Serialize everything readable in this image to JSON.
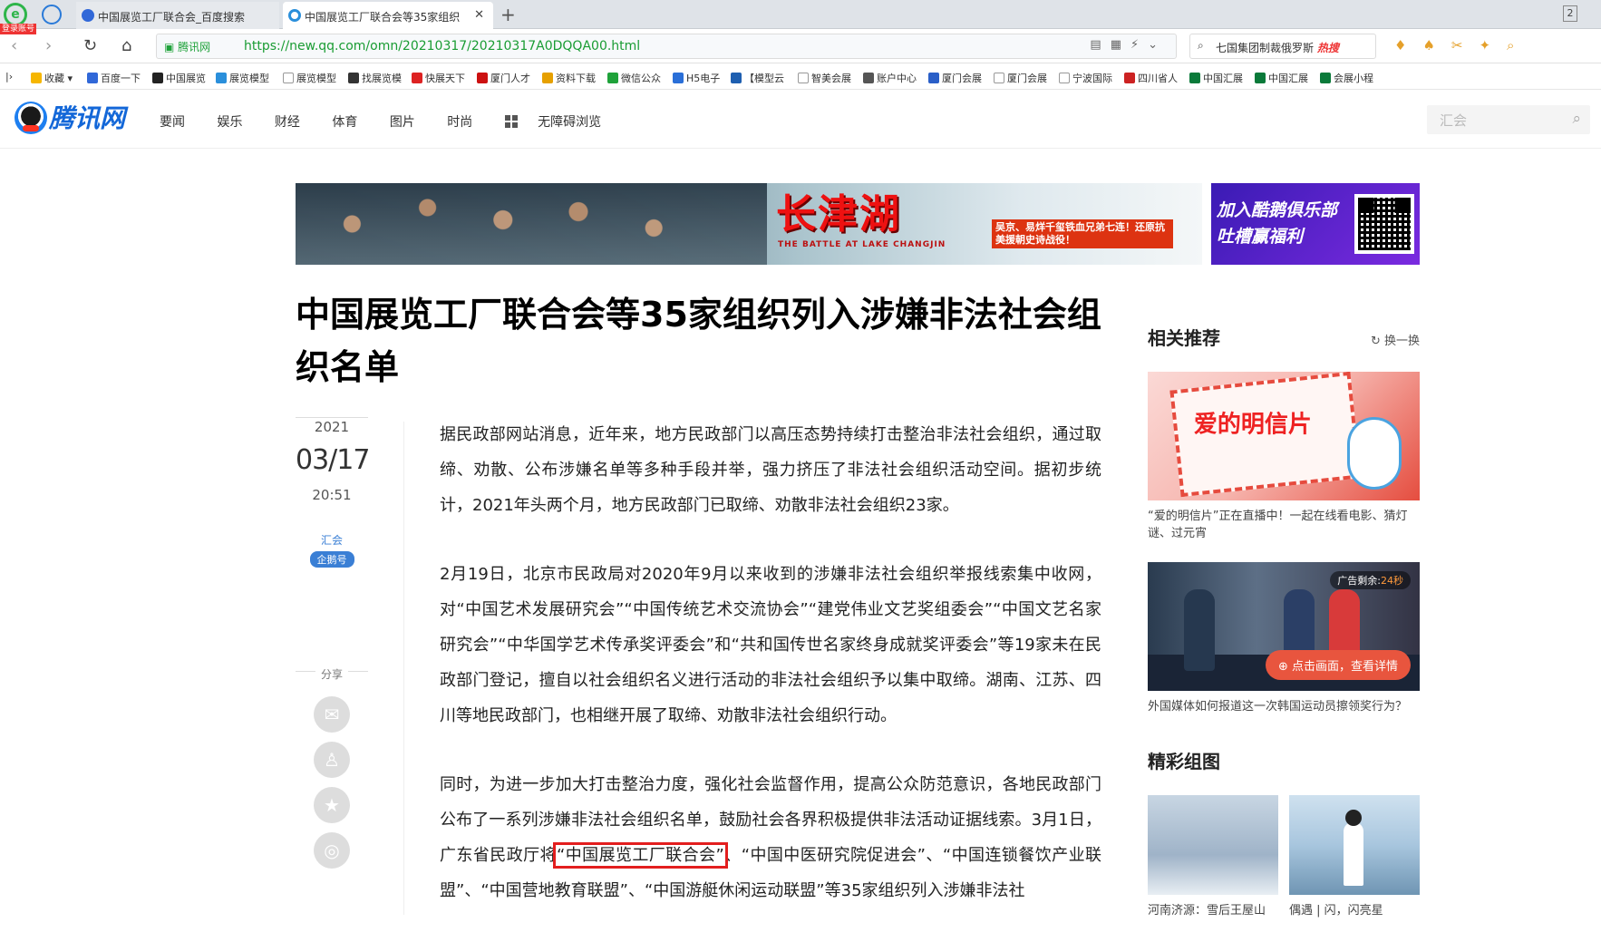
{
  "browser": {
    "logo_glyph": "e",
    "login_badge": "登录账号",
    "tabs": [
      {
        "title": "中国展览工厂联合会_百度搜索",
        "active": false
      },
      {
        "title": "中国展览工厂联合会等35家组织",
        "active": true
      }
    ],
    "new_tab": "+",
    "close": "✕",
    "window_count": "2",
    "url_site": "腾讯网",
    "url": "https://new.qq.com/omn/20210317/20210317A0DQQA00.html",
    "search_text": "七国集团制裁俄罗斯",
    "search_hot": "热搜",
    "bookmarks": [
      "收藏",
      "百度一下",
      "中国展览",
      "展览模型",
      "展览模型",
      "找展览模",
      "快展天下",
      "厦门人才",
      "资料下载",
      "微信公众",
      "H5电子",
      "【模型云",
      "智美会展",
      "账户中心",
      "厦门会展",
      "厦门会展",
      "宁波国际",
      "四川省人",
      "中国汇展",
      "中国汇展",
      "会展小程"
    ]
  },
  "site": {
    "name": "腾讯网",
    "nav": [
      "要闻",
      "娱乐",
      "财经",
      "体育",
      "图片",
      "时尚"
    ],
    "accessibility": "无障碍浏览",
    "search_placeholder": "汇会"
  },
  "banner": {
    "title": "长津湖",
    "subtitle": "THE BATTLE AT LAKE CHANGJIN",
    "slogan": "吴京、易烊千玺铁血兄弟七连！还原抗美援朝史诗战役！",
    "right_text_1": "加入酷鹅俱乐部",
    "right_text_2": "吐槽赢福利"
  },
  "article": {
    "title": "中国展览工厂联合会等35家组织列入涉嫌非法社会组织名单",
    "year": "2021",
    "date": "03/17",
    "time": "20:51",
    "author": "汇会",
    "author_badge": "企鹅号",
    "share_label": "分享",
    "p1": "据民政部网站消息，近年来，地方民政部门以高压态势持续打击整治非法社会组织，通过取缔、劝散、公布涉嫌名单等多种手段并举，强力挤压了非法社会组织活动空间。据初步统计，2021年头两个月，地方民政部门已取缔、劝散非法社会组织23家。",
    "p2": "2月19日，北京市民政局对2020年9月以来收到的涉嫌非法社会组织举报线索集中收网，对“中国艺术发展研究会”“中国传统艺术交流协会”“建党伟业文艺奖组委会”“中国文艺名家研究会”“中华国学艺术传承奖评委会”和“共和国传世名家终身成就奖评委会”等19家未在民政部门登记，擅自以社会组织名义进行活动的非法社会组织予以集中取缔。湖南、江苏、四川等地民政部门，也相继开展了取缔、劝散非法社会组织行动。",
    "p3_before": "同时，为进一步加大打击整治力度，强化社会监督作用，提高公众防范意识，各地民政部门公布了一系列涉嫌非法社会组织名单，鼓励社会各界积极提供非法活动证据线索。3月1日，广东省民政厅将",
    "p3_highlight": "“中国展览工厂联合会”",
    "p3_after": "、“中国中医研究院促进会”、“中国连锁餐饮产业联盟”、“中国营地教育联盟”、“中国游艇休闲运动联盟”等35家组织列入涉嫌非法社"
  },
  "sidebar": {
    "related_title": "相关推荐",
    "refresh_label": "换一换",
    "card1_img_text": "爱的明信片",
    "card1_caption": "“爱的明信片”正在直播中！一起在线看电影、猜灯谜、过元宵",
    "ad_count_label": "广告剩余:",
    "ad_count_value": "24秒",
    "ad_cta": "点击画面，查看详情",
    "card2_caption": "外国媒体如何报道这一次韩国运动员擦领奖行为？",
    "gallery_title": "精彩组图",
    "thumb1_caption": "河南济源：雪后王屋山",
    "thumb2_caption": "偶遇 | 闪，闪亮星"
  },
  "colors": {
    "brand_blue": "#1367d8",
    "highlight_red": "#e31e1e",
    "url_green": "#1a9c33"
  }
}
